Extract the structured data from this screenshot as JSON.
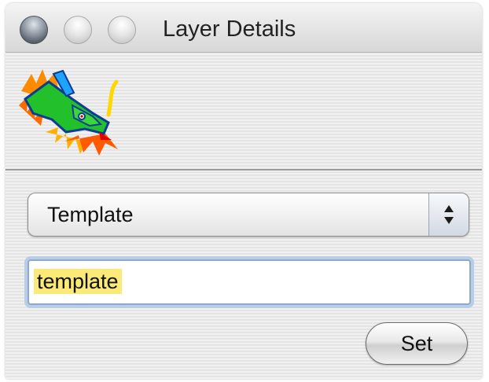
{
  "window": {
    "title": "Layer Details"
  },
  "icons": {
    "close": "close-button-icon",
    "minimize": "minimize-button-icon",
    "zoom": "zoom-button-icon",
    "logo": "dragon-logo-icon",
    "select_arrows": "up-down-arrows-icon"
  },
  "layer": {
    "select_value": "Template",
    "name_value": "template",
    "set_label": "Set"
  },
  "colors": {
    "selection_highlight": "#fbea77",
    "focus_ring": "#b8cde6"
  }
}
